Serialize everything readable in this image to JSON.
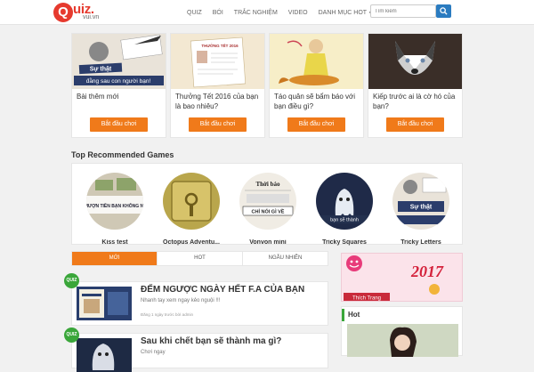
{
  "header": {
    "logo_text": "uiz.",
    "logo_letter": "Q",
    "logo_sub": "vui.vn",
    "nav": [
      {
        "label": "QUIZ"
      },
      {
        "label": "BÓI"
      },
      {
        "label": "TRẮC NGHIỆM"
      },
      {
        "label": "VIDEO"
      },
      {
        "label": "DANH MỤC HOT"
      }
    ],
    "search_placeholder": "Tìm kiếm"
  },
  "cards": [
    {
      "title": "Bài thêm mới",
      "button": "Bắt đầu chơi",
      "img_text_1": "Sự thật",
      "img_text_2": "đằng sau con người bạn!"
    },
    {
      "title": "Thưởng Tết 2016 của bạn là bao nhiêu?",
      "button": "Bắt đầu chơi",
      "img_text_1": "THƯỞNG TẾT 2016"
    },
    {
      "title": "Táo quân sẽ bẩm báo với bạn điều gì?",
      "button": "Bắt đầu chơi"
    },
    {
      "title": "Kiếp trước ai là cờ hó của bạn?",
      "button": "Bắt đầu chơi"
    }
  ],
  "recommended": {
    "title": "Top Recommended Games",
    "items": [
      {
        "label": "Kiss test",
        "img_text": "NG MƯỢN TIỀN BẠN KHÔNG NHỚ?"
      },
      {
        "label": "Octopus Adventu..."
      },
      {
        "label": "Vonvon mini",
        "img_text_1": "Thời báo",
        "img_text_2": "CHỈ NÓI GÌ VỀ"
      },
      {
        "label": "Tricky Squares",
        "img_text": "bạn sẽ thành"
      },
      {
        "label": "Tricky Letters",
        "img_text": "Sự thật"
      }
    ]
  },
  "tabs": [
    {
      "label": "MỚI",
      "active": true
    },
    {
      "label": "HOT",
      "active": false
    },
    {
      "label": "NGẪU NHIÊN",
      "active": false
    }
  ],
  "posts": [
    {
      "badge": "QUIZ",
      "title": "ĐẾM NGƯỢC NGÀY HẾT F.A CỦA BẠN",
      "excerpt": "Nhanh tay xem ngay kẻo nguội !!!",
      "meta": "Đăng 1 ngày trước bởi admin"
    },
    {
      "badge": "QUIZ",
      "title": "Sau khi chết bạn sẽ thành ma gì?",
      "excerpt": "Chơi ngay"
    }
  ],
  "sidebar": {
    "ad_year": "2017",
    "ad_like": "Thích Trang",
    "hot_title": "Hot"
  },
  "colors": {
    "accent": "#f07a1a",
    "brand": "#e63a2e",
    "search_button": "#2a7bc0",
    "badge": "#3aa63a"
  }
}
